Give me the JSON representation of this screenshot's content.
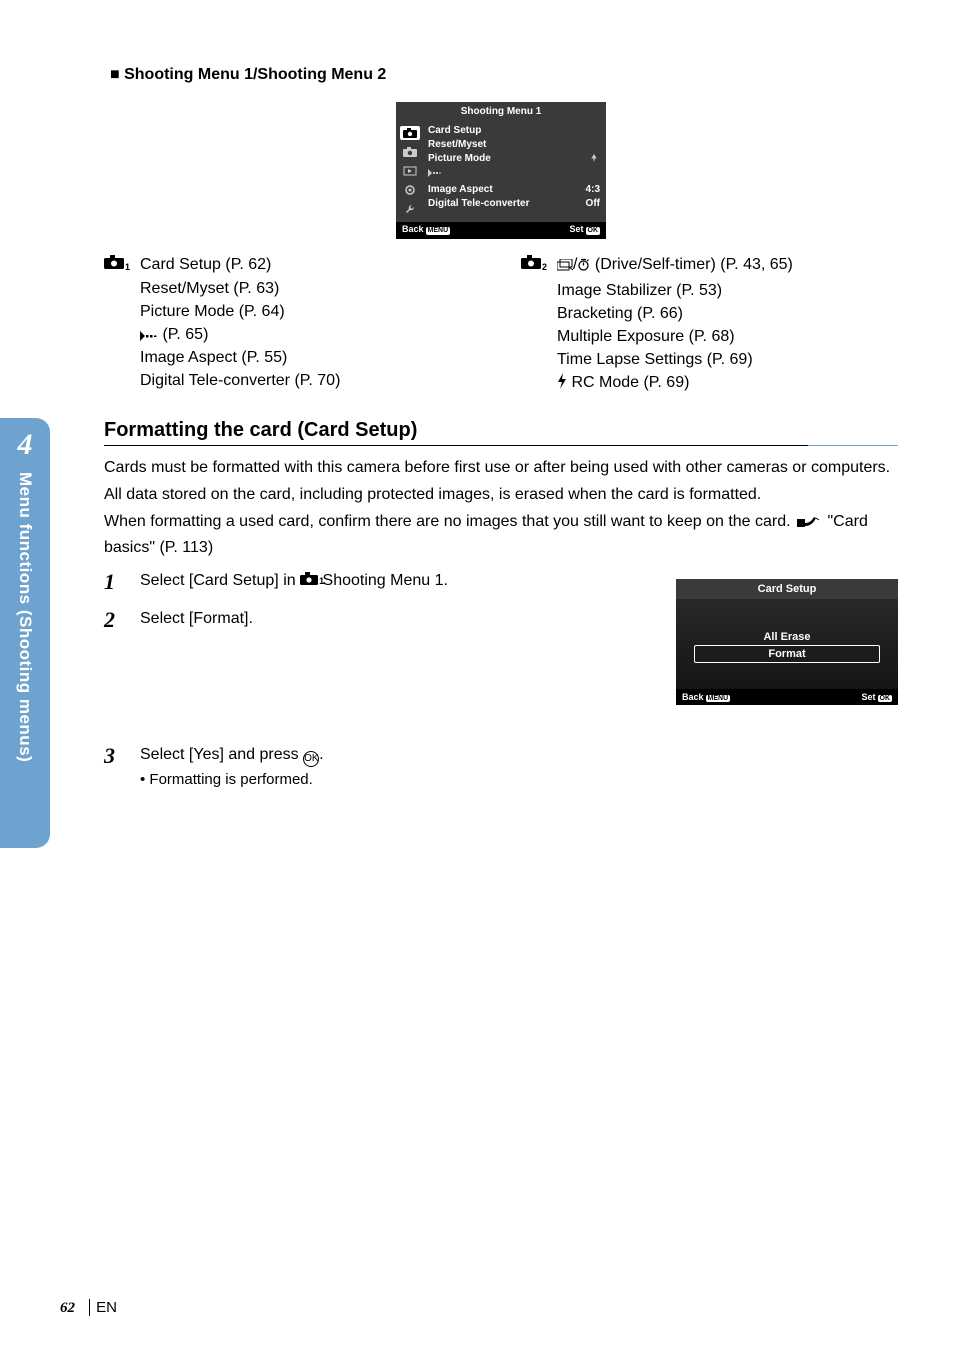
{
  "header": {
    "title": "Shooting Menu 1/Shooting Menu 2"
  },
  "menu_panel": {
    "title": "Shooting Menu 1",
    "rows": [
      {
        "label": "Card Setup",
        "value": ""
      },
      {
        "label": "Reset/Myset",
        "value": ""
      },
      {
        "label": "Picture Mode",
        "value": ""
      },
      {
        "label": "",
        "value": ""
      },
      {
        "label": "Image Aspect",
        "value": "4:3"
      },
      {
        "label": "Digital Tele-converter",
        "value": "Off"
      }
    ],
    "back": "Back",
    "set": "Set"
  },
  "lists": {
    "left": [
      "Card Setup (P. 62)",
      "Reset/Myset (P. 63)",
      "Picture Mode (P. 64)",
      " (P. 65)",
      "Image Aspect (P. 55)",
      "Digital Tele-converter (P. 70)"
    ],
    "right_first_prefix": "/",
    "right_first_suffix": " (Drive/Self-timer) (P. 43, 65)",
    "right": [
      "Image Stabilizer (P. 53)",
      "Bracketing (P. 66)",
      "Multiple Exposure (P. 68)",
      "Time Lapse Settings (P. 69)"
    ],
    "right_last": " RC Mode (P. 69)"
  },
  "section": {
    "heading": "Formatting the card (Card Setup)",
    "p1": "Cards must be formatted with this camera before first use or after being used with other cameras or computers.",
    "p2": "All data stored on the card, including protected images, is erased when the card is formatted.",
    "p3a": "When formatting a used card, confirm there are no images that you still want to keep on the card. ",
    "p3b": " \"Card basics\" (P. 113)"
  },
  "steps": {
    "s1a": "Select [Card Setup] in ",
    "s1b": " Shooting Menu 1.",
    "s2": "Select [Format].",
    "s3a": "Select [Yes] and press ",
    "s3b": ".",
    "s3sub": "Formatting is performed."
  },
  "card_setup_panel": {
    "title": "Card Setup",
    "items": [
      "All Erase",
      "Format"
    ],
    "back": "Back",
    "set": "Set"
  },
  "side": {
    "num": "4",
    "text": "Menu functions (Shooting menus)"
  },
  "footer": {
    "page": "62",
    "lang": "EN"
  },
  "ok_label": "OK"
}
